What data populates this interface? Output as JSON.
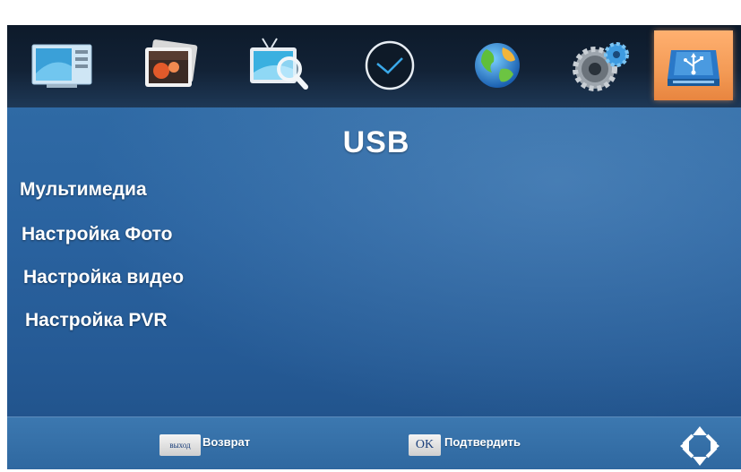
{
  "tabs": [
    {
      "id": "picture",
      "icon": "screen-icon"
    },
    {
      "id": "photo",
      "icon": "photo-icon"
    },
    {
      "id": "channel-search",
      "icon": "tv-search-icon"
    },
    {
      "id": "time",
      "icon": "clock-icon"
    },
    {
      "id": "language",
      "icon": "globe-icon"
    },
    {
      "id": "system",
      "icon": "gears-icon"
    },
    {
      "id": "usb",
      "icon": "usb-icon",
      "active": true
    }
  ],
  "title": "USB",
  "menu": [
    {
      "label": "Мультимедиа"
    },
    {
      "label": "Настройка Фото"
    },
    {
      "label": "Настройка видео"
    },
    {
      "label": "Настройка PVR"
    }
  ],
  "footer": {
    "exit_key": "выход",
    "exit_label": "Возврат",
    "ok_key": "OK",
    "ok_label": "Подтвердить",
    "nav_icon": "navigation-arrows-icon"
  },
  "colors": {
    "background": "#2a63a0",
    "top_bar": "#122236",
    "active_tab": "#f39a55",
    "text": "#ffffff"
  }
}
